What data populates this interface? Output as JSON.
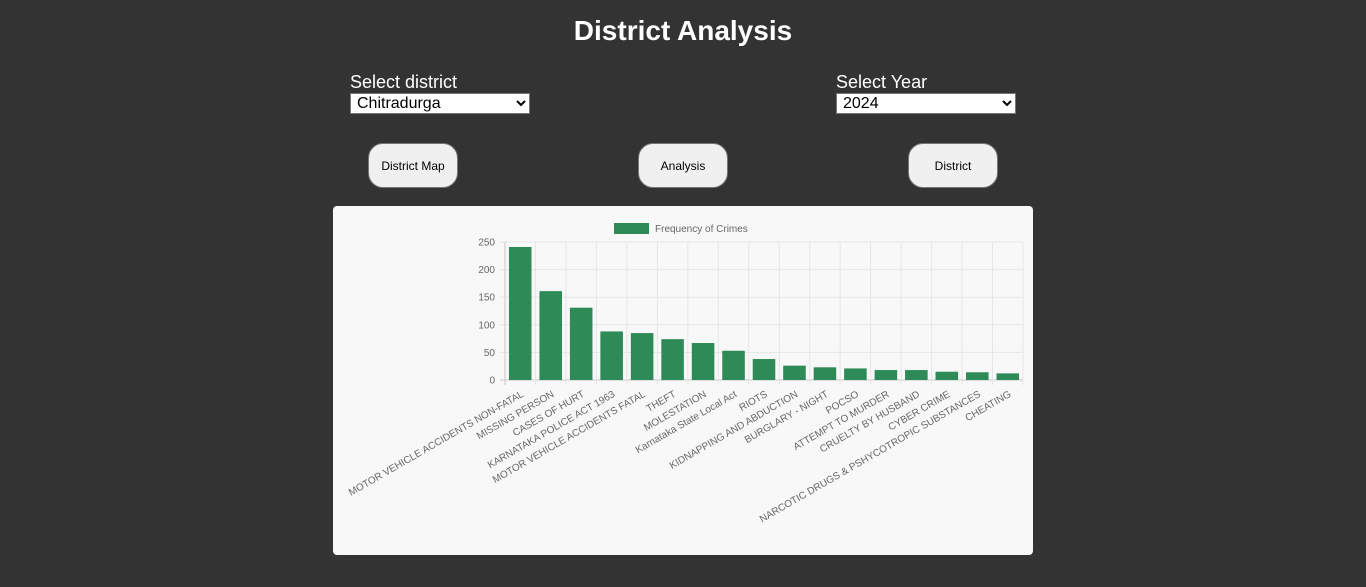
{
  "page": {
    "title": "District Analysis"
  },
  "filters": {
    "district_label": "Select district",
    "district_value": "Chitradurga",
    "year_label": "Select Year",
    "year_value": "2024"
  },
  "buttons": {
    "district_map": "District Map",
    "analysis": "Analysis",
    "district": "District"
  },
  "colors": {
    "bar": "#2e8b57",
    "background": "#333333",
    "panel": "#f8f8f8"
  },
  "chart_data": {
    "type": "bar",
    "legend": "Frequency of Crimes",
    "legend_position": "top",
    "grid": true,
    "ylim": [
      0,
      250
    ],
    "yticks": [
      0,
      50,
      100,
      150,
      200,
      250
    ],
    "categories": [
      "MOTOR VEHICLE ACCIDENTS NON-FATAL",
      "MISSING PERSON",
      "CASES OF HURT",
      "KARNATAKA POLICE ACT 1963",
      "MOTOR VEHICLE ACCIDENTS FATAL",
      "THEFT",
      "MOLESTATION",
      "Karnataka State Local Act",
      "RIOTS",
      "KIDNAPPING AND ABDUCTION",
      "BURGLARY - NIGHT",
      "POCSO",
      "ATTEMPT TO MURDER",
      "CRUELTY BY HUSBAND",
      "CYBER CRIME",
      "NARCOTIC DRUGS & PSHYCOTROPIC SUBSTANCES",
      "CHEATING"
    ],
    "series": [
      {
        "name": "Frequency of Crimes",
        "values": [
          241,
          161,
          131,
          88,
          85,
          74,
          67,
          53,
          38,
          26,
          23,
          21,
          18,
          18,
          15,
          14,
          12
        ]
      }
    ]
  }
}
